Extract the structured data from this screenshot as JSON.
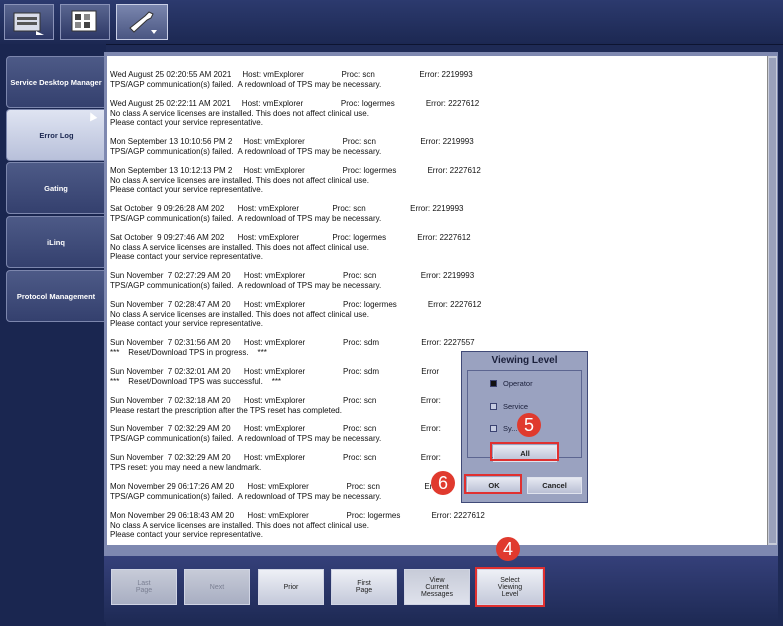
{
  "sidebar": {
    "items": [
      {
        "label": "Service Desktop Manager"
      },
      {
        "label": "Error Log"
      },
      {
        "label": "Gating"
      },
      {
        "label": "iLinq"
      },
      {
        "label": "Protocol Management"
      }
    ]
  },
  "log_entries": [
    {
      "lines": [
        "Wed August 25 02:20:55 AM 2021     Host: vmExplorer                 Proc: scn                    Error: 2219993",
        "TPS/AGP communication(s) failed.  A redownload of TPS may be necessary."
      ]
    },
    {
      "lines": [
        "Wed August 25 02:22:11 AM 2021     Host: vmExplorer                 Proc: logermes              Error: 2227612",
        "No class A service licenses are installed. This does not affect clinical use.",
        "Please contact your service representative."
      ]
    },
    {
      "lines": [
        "Mon September 13 10:10:56 PM 2     Host: vmExplorer                 Proc: scn                    Error: 2219993",
        "TPS/AGP communication(s) failed.  A redownload of TPS may be necessary."
      ]
    },
    {
      "lines": [
        "Mon September 13 10:12:13 PM 2     Host: vmExplorer                 Proc: logermes              Error: 2227612",
        "No class A service licenses are installed. This does not affect clinical use.",
        "Please contact your service representative."
      ]
    },
    {
      "lines": [
        "Sat October  9 09:26:28 AM 202      Host: vmExplorer               Proc: scn                    Error: 2219993",
        "TPS/AGP communication(s) failed.  A redownload of TPS may be necessary."
      ]
    },
    {
      "lines": [
        "Sat October  9 09:27:46 AM 202      Host: vmExplorer               Proc: logermes              Error: 2227612",
        "No class A service licenses are installed. This does not affect clinical use.",
        "Please contact your service representative."
      ]
    },
    {
      "lines": [
        "Sun November  7 02:27:29 AM 20      Host: vmExplorer                 Proc: scn                    Error: 2219993",
        "TPS/AGP communication(s) failed.  A redownload of TPS may be necessary."
      ]
    },
    {
      "lines": [
        "Sun November  7 02:28:47 AM 20      Host: vmExplorer                 Proc: logermes              Error: 2227612",
        "No class A service licenses are installed. This does not affect clinical use.",
        "Please contact your service representative."
      ]
    },
    {
      "lines": [
        "Sun November  7 02:31:56 AM 20      Host: vmExplorer                 Proc: sdm                   Error: 2227557",
        "***    Reset/Download TPS in progress.    ***"
      ]
    },
    {
      "lines": [
        "Sun November  7 02:32:01 AM 20      Host: vmExplorer                 Proc: sdm                   Error",
        "***    Reset/Download TPS was successful.    ***"
      ]
    },
    {
      "lines": [
        "Sun November  7 02:32:18 AM 20      Host: vmExplorer                 Proc: scn                    Error:",
        "Please restart the prescription after the TPS reset has completed."
      ]
    },
    {
      "lines": [
        "Sun November  7 02:32:29 AM 20      Host: vmExplorer                 Proc: scn                    Error:",
        "TPS/AGP communication(s) failed.  A redownload of TPS may be necessary."
      ]
    },
    {
      "lines": [
        "Sun November  7 02:32:29 AM 20      Host: vmExplorer                 Proc: scn                    Error:",
        "TPS reset: you may need a new landmark."
      ]
    },
    {
      "lines": [
        "Mon November 29 06:17:26 AM 20      Host: vmExplorer                 Proc: scn                    Error:",
        "TPS/AGP communication(s) failed.  A redownload of TPS may be necessary."
      ]
    },
    {
      "lines": [
        "Mon November 29 06:18:43 AM 20      Host: vmExplorer                 Proc: logermes              Error: 2227612",
        "No class A service licenses are installed. This does not affect clinical use.",
        "Please contact your service representative."
      ]
    }
  ],
  "bottom_buttons": [
    {
      "label": "Last\nPage",
      "state": "disabled"
    },
    {
      "label": "Next",
      "state": "disabled"
    },
    {
      "label": "Prior",
      "state": "enabled"
    },
    {
      "label": "First\nPage",
      "state": "enabled"
    },
    {
      "label": "View\nCurrent\nMessages",
      "state": "pressed"
    },
    {
      "label": "Select\nViewing\nLevel",
      "state": "highlighted"
    }
  ],
  "dialog": {
    "title": "Viewing Level",
    "options": [
      {
        "label": "Operator",
        "checked": true
      },
      {
        "label": "Service",
        "checked": false
      },
      {
        "label": "Sy...",
        "checked": false
      }
    ],
    "all_label": "All",
    "ok_label": "OK",
    "cancel_label": "Cancel"
  },
  "markers": [
    "4",
    "5",
    "6"
  ],
  "colors": {
    "highlight": "#e03030",
    "marker": "#e03a2e"
  }
}
